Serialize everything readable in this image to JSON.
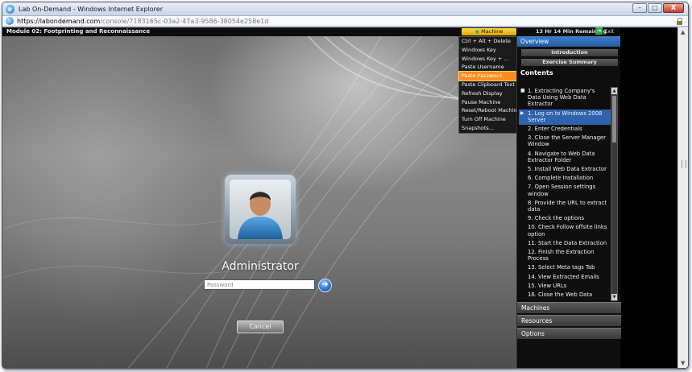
{
  "window": {
    "title": "Lab On-Demand - Windows Internet Explorer",
    "minimize": "–",
    "maximize": "□",
    "close": "X"
  },
  "address": {
    "url_scheme": "https://",
    "url_host": "labondemand.com",
    "url_path": "/console/7183165c-03a2-47a3-9586-38054e258e1d"
  },
  "lod": {
    "module_title": "Module 02: Footprinting and Reconnaissance",
    "machine_commands_label": "Machine Commands",
    "time_remaining": "13 Hr 14 Min Remaining",
    "exit_label": "Exit"
  },
  "machine_menu": {
    "items": [
      {
        "label": "Ctrl + Alt + Delete"
      },
      {
        "label": "Windows Key"
      },
      {
        "label": "Windows Key + ..."
      },
      {
        "label": "Paste Username"
      },
      {
        "label": "Paste Password"
      },
      {
        "label": "Paste Clipboard Text"
      },
      {
        "label": "Refresh Display"
      },
      {
        "label": "Pause Machine"
      },
      {
        "label": "Reset/Reboot Machine"
      },
      {
        "label": "Turn Off Machine"
      },
      {
        "label": "Snapshots..."
      }
    ],
    "selected_index": 4,
    "highlight_color": "#ff8c1a"
  },
  "login": {
    "user_name": "Administrator",
    "password_placeholder": "Password",
    "go_symbol": "➔",
    "cancel_label": "Cancel"
  },
  "panel": {
    "overview_label": "Overview",
    "introduction_label": "Introduction",
    "exercise_summary_label": "Exercise Summary",
    "contents_title": "Contents",
    "toc": [
      {
        "marker": "■",
        "label": "1. Extracting Company's Data Using Web Data Extractor"
      },
      {
        "marker": "▶",
        "label": "1. Log on to Windows 2008 Server",
        "active": true
      },
      {
        "marker": "",
        "label": "2. Enter Credentials"
      },
      {
        "marker": "",
        "label": "3. Close the Server Manager Window"
      },
      {
        "marker": "",
        "label": "4. Navigate to Web Data Extractor Folder"
      },
      {
        "marker": "",
        "label": "5. Install Web Data Extractor"
      },
      {
        "marker": "",
        "label": "6. Complete Installation"
      },
      {
        "marker": "",
        "label": "7. Open Session settings window"
      },
      {
        "marker": "",
        "label": "8. Provide the URL to extract data"
      },
      {
        "marker": "",
        "label": "9. Check the options"
      },
      {
        "marker": "",
        "label": "10. Check Follow offsite links option"
      },
      {
        "marker": "",
        "label": "11. Start the Data Extraction"
      },
      {
        "marker": "",
        "label": "12. Finish the Extraction Process"
      },
      {
        "marker": "",
        "label": "13. Select Meta tags Tab"
      },
      {
        "marker": "",
        "label": "14. View Extracted Emails"
      },
      {
        "marker": "",
        "label": "15. View URLs"
      },
      {
        "marker": "",
        "label": "16. Close the Web Data"
      }
    ],
    "machines_label": "Machines",
    "resources_label": "Resources",
    "options_label": "Options"
  },
  "colors": {
    "panel_header": "#245da5",
    "active_toc": "#2f63ad",
    "machine_commands": "#e0a600"
  }
}
